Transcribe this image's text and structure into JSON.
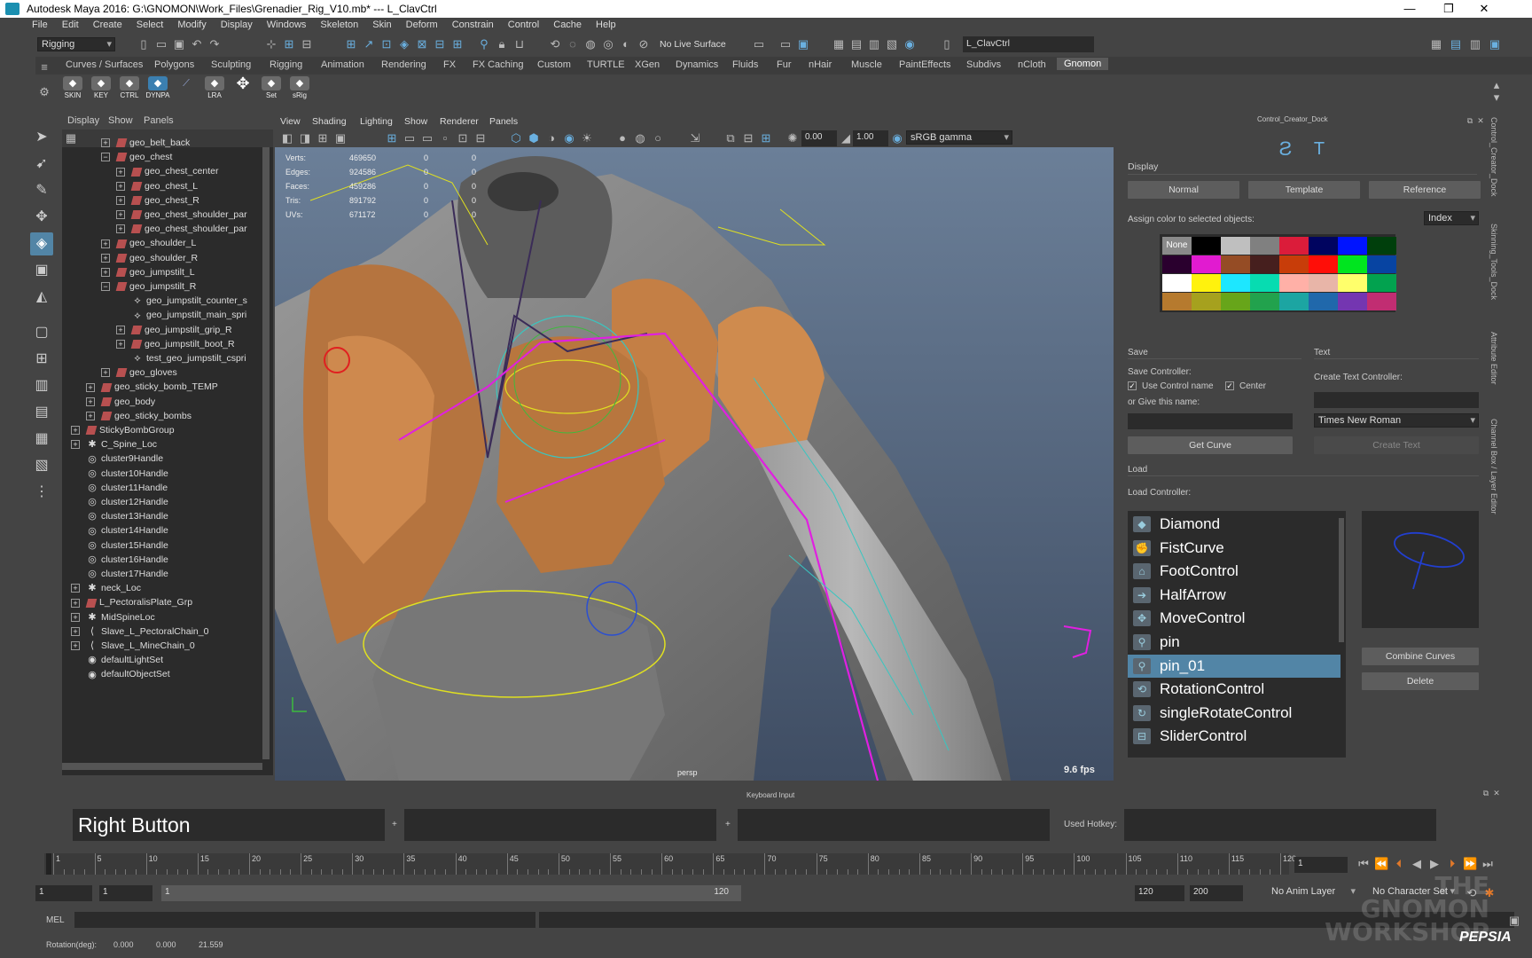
{
  "titlebar": {
    "title": "Autodesk Maya 2016: G:\\GNOMON\\Work_Files\\Grenadier_Rig_V10.mb*  ---  L_ClavCtrl",
    "minimize": "—",
    "maximize": "❐",
    "close": "✕"
  },
  "menu": [
    "File",
    "Edit",
    "Create",
    "Select",
    "Modify",
    "Display",
    "Windows",
    "Skeleton",
    "Skin",
    "Deform",
    "Constrain",
    "Control",
    "Cache",
    "Help"
  ],
  "status": {
    "menuset": "Rigging",
    "live_surface": "No Live Surface",
    "object_name": "L_ClavCtrl"
  },
  "shelf_tabs": [
    "Curves / Surfaces",
    "Polygons",
    "Sculpting",
    "Rigging",
    "Animation",
    "Rendering",
    "FX",
    "FX Caching",
    "Custom",
    "TURTLE",
    "XGen",
    "Dynamics",
    "Fluids",
    "Fur",
    "nHair",
    "Muscle",
    "PaintEffects",
    "Subdivs",
    "nCloth",
    "Gnomon"
  ],
  "shelf_active": "Gnomon",
  "shelf_buttons": [
    "SKIN",
    "KEY",
    "CTRL",
    "DYNPA",
    "",
    "LRA",
    "",
    "Set",
    "sRig"
  ],
  "outliner": {
    "menu": [
      "Display",
      "Show",
      "Panels"
    ],
    "items": [
      {
        "label": "geo_belt_back",
        "depth": 2,
        "exp": "+",
        "icon": "mesh"
      },
      {
        "label": "geo_chest",
        "depth": 2,
        "exp": "−",
        "icon": "mesh"
      },
      {
        "label": "geo_chest_center",
        "depth": 3,
        "exp": "+",
        "icon": "mesh"
      },
      {
        "label": "geo_chest_L",
        "depth": 3,
        "exp": "+",
        "icon": "mesh"
      },
      {
        "label": "geo_chest_R",
        "depth": 3,
        "exp": "+",
        "icon": "mesh"
      },
      {
        "label": "geo_chest_shoulder_par",
        "depth": 3,
        "exp": "+",
        "icon": "mesh"
      },
      {
        "label": "geo_chest_shoulder_par",
        "depth": 3,
        "exp": "+",
        "icon": "mesh"
      },
      {
        "label": "geo_shoulder_L",
        "depth": 2,
        "exp": "+",
        "icon": "mesh"
      },
      {
        "label": "geo_shoulder_R",
        "depth": 2,
        "exp": "+",
        "icon": "mesh"
      },
      {
        "label": "geo_jumpstilt_L",
        "depth": 2,
        "exp": "+",
        "icon": "mesh"
      },
      {
        "label": "geo_jumpstilt_R",
        "depth": 2,
        "exp": "−",
        "icon": "mesh"
      },
      {
        "label": "geo_jumpstilt_counter_s",
        "depth": 3,
        "exp": "",
        "icon": "node"
      },
      {
        "label": "geo_jumpstilt_main_spri",
        "depth": 3,
        "exp": "",
        "icon": "node"
      },
      {
        "label": "geo_jumpstilt_grip_R",
        "depth": 3,
        "exp": "+",
        "icon": "mesh"
      },
      {
        "label": "geo_jumpstilt_boot_R",
        "depth": 3,
        "exp": "+",
        "icon": "mesh"
      },
      {
        "label": "test_geo_jumpstilt_cspri",
        "depth": 3,
        "exp": "",
        "icon": "node"
      },
      {
        "label": "geo_gloves",
        "depth": 2,
        "exp": "+",
        "icon": "mesh"
      },
      {
        "label": "geo_sticky_bomb_TEMP",
        "depth": 1,
        "exp": "+",
        "icon": "mesh"
      },
      {
        "label": "geo_body",
        "depth": 1,
        "exp": "+",
        "icon": "mesh"
      },
      {
        "label": "geo_sticky_bombs",
        "depth": 1,
        "exp": "+",
        "icon": "mesh"
      },
      {
        "label": "StickyBombGroup",
        "depth": 0,
        "exp": "+",
        "icon": "mesh"
      },
      {
        "label": "C_Spine_Loc",
        "depth": 0,
        "exp": "+",
        "icon": "loc"
      },
      {
        "label": "cluster9Handle",
        "depth": 0,
        "exp": "",
        "icon": "cluster"
      },
      {
        "label": "cluster10Handle",
        "depth": 0,
        "exp": "",
        "icon": "cluster"
      },
      {
        "label": "cluster11Handle",
        "depth": 0,
        "exp": "",
        "icon": "cluster"
      },
      {
        "label": "cluster12Handle",
        "depth": 0,
        "exp": "",
        "icon": "cluster"
      },
      {
        "label": "cluster13Handle",
        "depth": 0,
        "exp": "",
        "icon": "cluster"
      },
      {
        "label": "cluster14Handle",
        "depth": 0,
        "exp": "",
        "icon": "cluster"
      },
      {
        "label": "cluster15Handle",
        "depth": 0,
        "exp": "",
        "icon": "cluster"
      },
      {
        "label": "cluster16Handle",
        "depth": 0,
        "exp": "",
        "icon": "cluster"
      },
      {
        "label": "cluster17Handle",
        "depth": 0,
        "exp": "",
        "icon": "cluster"
      },
      {
        "label": "neck_Loc",
        "depth": 0,
        "exp": "+",
        "icon": "loc"
      },
      {
        "label": "L_PectoralisPlate_Grp",
        "depth": 0,
        "exp": "+",
        "icon": "mesh"
      },
      {
        "label": "MidSpineLoc",
        "depth": 0,
        "exp": "+",
        "icon": "loc"
      },
      {
        "label": "Slave_L_PectoralChain_0",
        "depth": 0,
        "exp": "+",
        "icon": "joint"
      },
      {
        "label": "Slave_L_MineChain_0",
        "depth": 0,
        "exp": "+",
        "icon": "joint"
      },
      {
        "label": "defaultLightSet",
        "depth": 0,
        "exp": "",
        "icon": "set"
      },
      {
        "label": "defaultObjectSet",
        "depth": 0,
        "exp": "",
        "icon": "set"
      }
    ]
  },
  "viewport": {
    "menu": [
      "View",
      "Shading",
      "Lighting",
      "Show",
      "Renderer",
      "Panels"
    ],
    "exposure": "0.00",
    "gamma": "1.00",
    "color_space": "sRGB gamma",
    "hud_labels": [
      "Verts:",
      "Edges:",
      "Faces:",
      "Tris:",
      "UVs:"
    ],
    "hud_values": [
      "469650",
      "924586",
      "459286",
      "891792",
      "671172"
    ],
    "hud_zero": "0",
    "camera": "persp",
    "fps": "9.6 fps"
  },
  "dock": {
    "title": "Control_Creator_Dock",
    "display_label": "Display",
    "display_buttons": [
      "Normal",
      "Template",
      "Reference"
    ],
    "assign_label": "Assign color to selected objects:",
    "assign_mode": "Index",
    "none_label": "None",
    "swatches": [
      "none",
      "#000000",
      "#bfbfbf",
      "#808080",
      "#db1c3a",
      "#00045f",
      "#0014ff",
      "#003f0c",
      "#2a002e",
      "#e11bd0",
      "#954c25",
      "#461f1e",
      "#c83d09",
      "#ff0e08",
      "#00e51f",
      "#0744a2",
      "#ffffff",
      "#fff20d",
      "#1de7ff",
      "#07dcb1",
      "#ffb0a7",
      "#e8b5a8",
      "#ffff6b",
      "#02a24f",
      "#b67a2e",
      "#a6a11e",
      "#67a51a",
      "#22a24d",
      "#1ca5a2",
      "#2068ab",
      "#7436b1",
      "#c12d72"
    ],
    "save_label": "Save",
    "text_label": "Text",
    "save_controller": "Save Controller:",
    "use_control_name": "Use Control name",
    "center": "Center",
    "give_name": "or Give this name:",
    "get_curve": "Get Curve",
    "create_text_controller": "Create Text Controller:",
    "font": "Times New Roman",
    "create_text": "Create Text",
    "load_label": "Load",
    "load_controller": "Load Controller:",
    "controllers": [
      "Diamond",
      "FistCurve",
      "FootControl",
      "HalfArrow",
      "MoveControl",
      "pin",
      "pin_01",
      "RotationControl",
      "singleRotateControl",
      "SliderControl"
    ],
    "selected_controller": "pin_01",
    "combine_curves": "Combine Curves",
    "delete": "Delete"
  },
  "right_tabs": [
    "Control_Creator_Dock",
    "Skinning_Tools_Dock",
    "Attribute Editor",
    "Channel Box / Layer Editor"
  ],
  "hotkey": {
    "title": "Keyboard Input",
    "field1": "Right Button",
    "plus": "+",
    "used_hotkey": "Used Hotkey:"
  },
  "timeline": {
    "ticks": [
      "1",
      "5",
      "10",
      "15",
      "20",
      "25",
      "30",
      "35",
      "40",
      "45",
      "50",
      "55",
      "60",
      "65",
      "70",
      "75",
      "80",
      "85",
      "90",
      "95",
      "100",
      "105",
      "110",
      "115",
      "120"
    ],
    "current_frame": "1",
    "range_start": "1",
    "playback_start": "1",
    "slider_start": "1",
    "slider_end": "120",
    "playback_end": "120",
    "range_end": "200",
    "anim_layer": "No Anim Layer",
    "character_set": "No Character Set"
  },
  "mel": {
    "label": "MEL"
  },
  "helpline": {
    "text": "Rotation(deg):",
    "v1": "0.000",
    "v2": "0.000",
    "v3": "21.559"
  },
  "watermark": {
    "line1": "THE GNOMON",
    "line2": "WORKSHOP",
    "tag": "PEPSIA"
  },
  "colors": {
    "accent": "#5285a6",
    "panel": "#444444",
    "field": "#2b2b2b"
  }
}
